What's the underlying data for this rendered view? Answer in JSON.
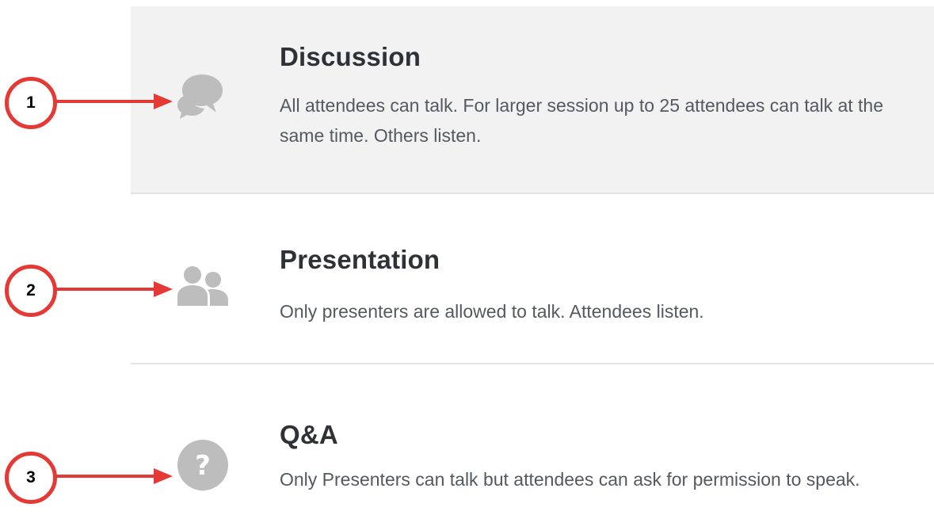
{
  "accent_color": "#e53935",
  "icon_color": "#bdbdbd",
  "options": [
    {
      "title": "Discussion",
      "description": "All attendees can talk. For larger session up to 25 attendees can talk at the same time. Others listen.",
      "icon": "chat-bubbles-icon",
      "selected": true
    },
    {
      "title": "Presentation",
      "description": "Only presenters are allowed to talk. Attendees listen.",
      "icon": "users-icon",
      "selected": false
    },
    {
      "title": "Q&A",
      "description": "Only Presenters can talk but attendees can ask for permission to speak.",
      "icon": "question-circle-icon",
      "selected": false
    }
  ],
  "callouts": [
    {
      "number": "1"
    },
    {
      "number": "2"
    },
    {
      "number": "3"
    }
  ]
}
